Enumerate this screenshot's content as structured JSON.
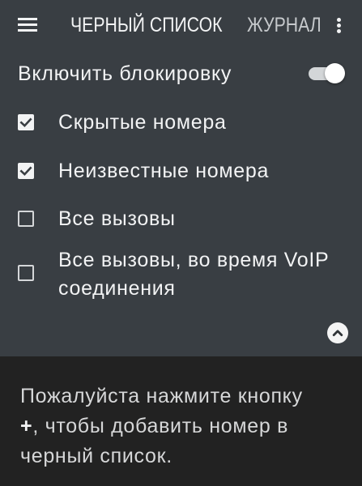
{
  "toolbar": {
    "menu_icon": "menu-icon",
    "tabs": [
      {
        "label": "ЧЕРНЫЙ СПИСОК",
        "selected": true
      },
      {
        "label": "ЖУРНАЛ",
        "selected": false
      }
    ],
    "overflow_icon": "more-vert-icon"
  },
  "settings": {
    "enable_blocking": {
      "label": "Включить блокировку",
      "on": true
    },
    "options": [
      {
        "label": "Скрытые номера",
        "checked": true
      },
      {
        "label": "Неизвестные номера",
        "checked": true
      },
      {
        "label": "Все вызовы",
        "checked": false
      },
      {
        "label": "Все вызовы, во время VoIP соединения",
        "checked": false
      }
    ],
    "collapse_icon": "chevron-up-icon"
  },
  "empty_state": {
    "line1": "Пожалуйста нажмите кнопку",
    "plus": "+",
    "line2": ", чтобы добавить номер в",
    "line3": "черный список."
  },
  "colors": {
    "background": "#393e43",
    "bottom_panel": "#222222",
    "text": "#f2f3f4",
    "muted_text": "#d6d7d8",
    "tab_inactive": "#c6c9cc"
  }
}
